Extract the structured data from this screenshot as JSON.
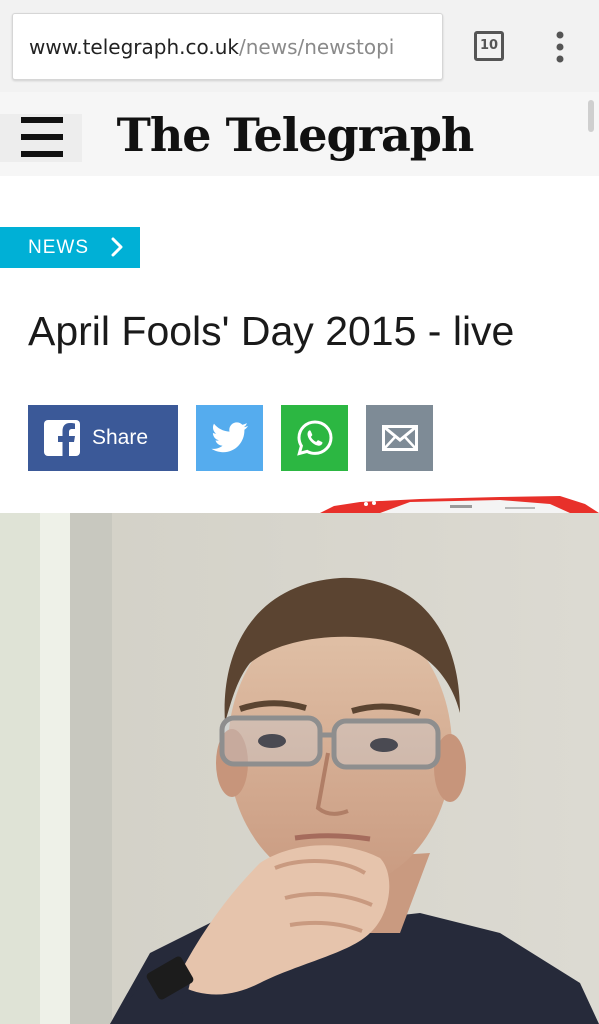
{
  "browser": {
    "url_host": "www.telegraph.co.uk",
    "url_path": "/news/newstopi",
    "tab_count": "10",
    "menu_icon": "overflow-dots-icon"
  },
  "header": {
    "brand": "The Telegraph",
    "menu_icon": "hamburger-menu-icon"
  },
  "article": {
    "section_label": "NEWS",
    "headline": "April Fools' Day 2015 - live"
  },
  "share": {
    "facebook_label": "Share",
    "facebook_icon": "facebook-icon",
    "twitter_icon": "twitter-icon",
    "whatsapp_icon": "whatsapp-icon",
    "email_icon": "email-icon"
  },
  "colors": {
    "news_tag": "#00b0d6",
    "facebook": "#3b5998",
    "twitter": "#55acee",
    "whatsapp": "#2cb742",
    "email": "#7e8b96"
  }
}
